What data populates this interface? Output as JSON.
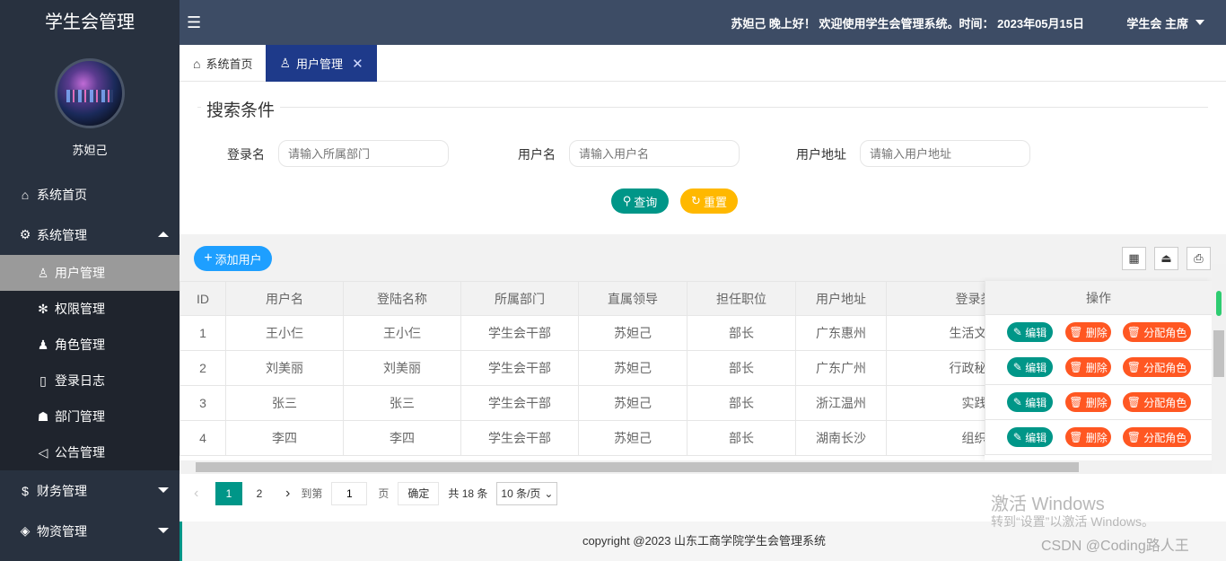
{
  "app": {
    "title": "学生会管理",
    "user_name": "苏妲己"
  },
  "header": {
    "greeting": "苏妲己 晚上好！ 欢迎使用学生会管理系统。时间： 2023年05月15日",
    "role": "学生会 主席"
  },
  "sidebar": {
    "home": "系统首页",
    "system": "系统管理",
    "sub_items": [
      "用户管理",
      "权限管理",
      "角色管理",
      "登录日志",
      "部门管理",
      "公告管理"
    ],
    "finance": "财务管理",
    "materials": "物资管理"
  },
  "tabs": [
    {
      "label": "系统首页"
    },
    {
      "label": "用户管理",
      "close": "✕"
    }
  ],
  "search": {
    "legend": "搜索条件",
    "login_label": "登录名",
    "login_placeholder": "请输入所属部门",
    "user_label": "用户名",
    "user_placeholder": "请输入用户名",
    "addr_label": "用户地址",
    "addr_placeholder": "请输入用户地址",
    "query": "查询",
    "reset": "重置"
  },
  "table": {
    "add_button": "添加用户",
    "columns": [
      "ID",
      "用户名",
      "登陆名称",
      "所属部门",
      "直属领导",
      "担任职位",
      "用户地址",
      "登录类型"
    ],
    "ops_header": "操作",
    "op_edit": "编辑",
    "op_delete": "删除",
    "op_role": "分配角色",
    "rows": [
      [
        "1",
        "王小仨",
        "王小仨",
        "学生会干部",
        "苏妲己",
        "部长",
        "广东惠州",
        "生活文体部"
      ],
      [
        "2",
        "刘美丽",
        "刘美丽",
        "学生会干部",
        "苏妲己",
        "部长",
        "广东广州",
        "行政秘书部"
      ],
      [
        "3",
        "张三",
        "张三",
        "学生会干部",
        "苏妲己",
        "部长",
        "浙江温州",
        "实践部"
      ],
      [
        "4",
        "李四",
        "李四",
        "学生会干部",
        "苏妲己",
        "部长",
        "湖南长沙",
        "组织部"
      ]
    ]
  },
  "pager": {
    "pages": [
      "1",
      "2"
    ],
    "goto_prefix": "到第",
    "goto_value": "1",
    "goto_suffix": "页",
    "confirm": "确定",
    "total": "共 18 条",
    "page_size": "10 条/页"
  },
  "footer": {
    "text": "copyright @2023 山东工商学院学生会管理系统"
  },
  "watermark": {
    "line1": "激活 Windows",
    "line2": "转到“设置”以激活 Windows。",
    "csdn": "CSDN @Coding路人王"
  },
  "colors": {
    "sidebar": "#28313f",
    "header": "#3d4c65",
    "primary": "#009688",
    "warn": "#ffb800",
    "danger": "#ff5722",
    "blue": "#1e9fff",
    "active_tab": "#1e3a8a"
  }
}
